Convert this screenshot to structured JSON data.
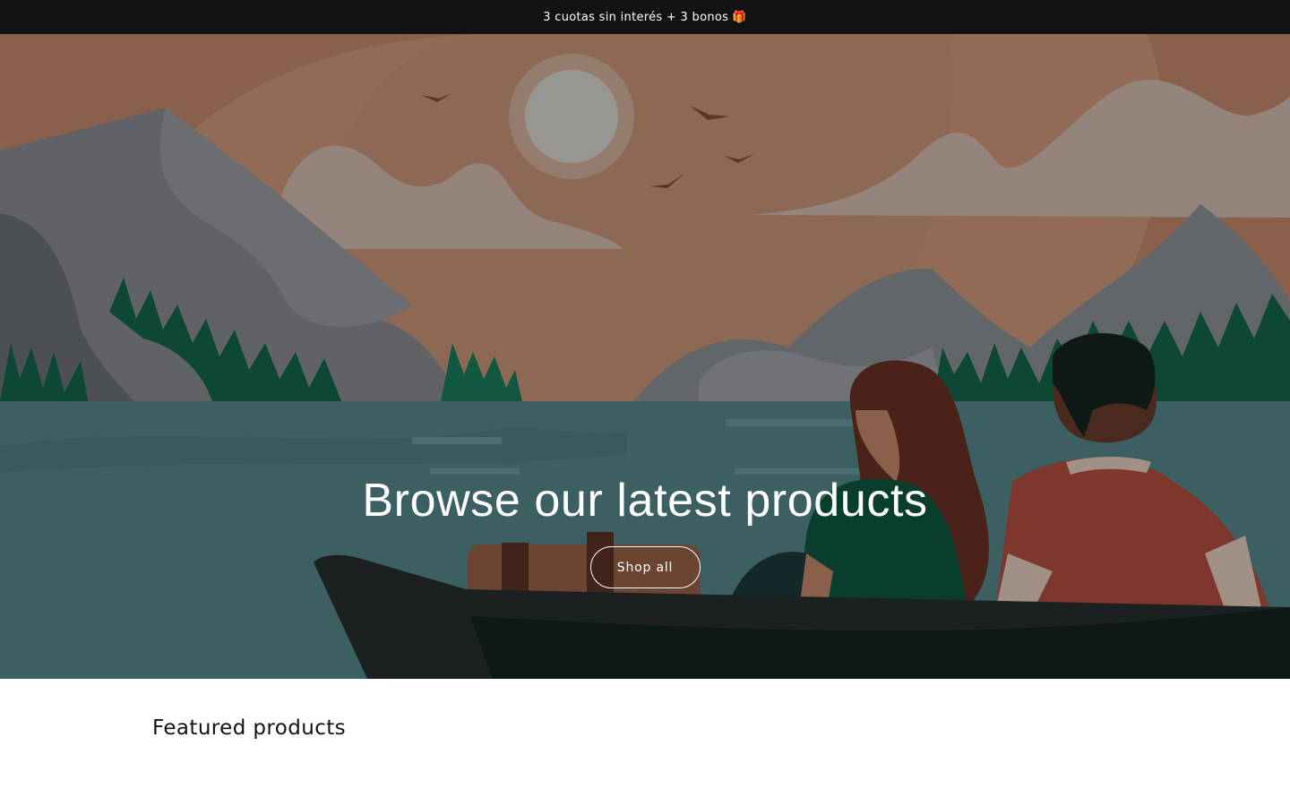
{
  "announcement": {
    "text": "3 cuotas sin interés + 3 bonos",
    "icon": "gift-icon",
    "icon_glyph": "🎁"
  },
  "hero": {
    "heading": "Browse our latest products",
    "button_label": "Shop all",
    "illustration": "lake-boat-landscape"
  },
  "featured": {
    "title": "Featured products"
  },
  "colors": {
    "announcement_bg": "#121212",
    "text_light": "#ffffff",
    "text_dark": "#121212"
  }
}
